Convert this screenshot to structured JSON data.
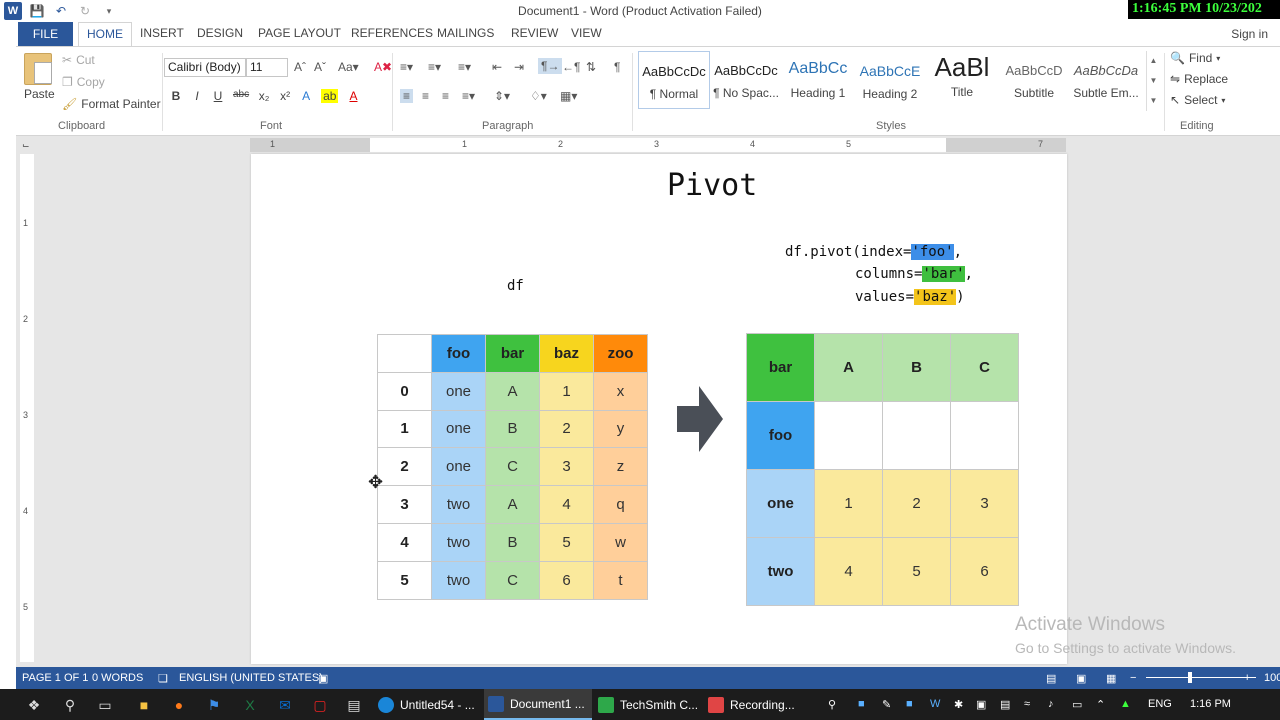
{
  "window": {
    "title": "Document1 - Word (Product Activation Failed)",
    "clock": "1:16:45 PM 10/23/202"
  },
  "tabs": [
    "FILE",
    "HOME",
    "INSERT",
    "DESIGN",
    "PAGE LAYOUT",
    "REFERENCES",
    "MAILINGS",
    "REVIEW",
    "VIEW"
  ],
  "signin": "Sign in",
  "ribbon": {
    "clipboard": {
      "paste": "Paste",
      "cut": "Cut",
      "copy": "Copy",
      "format_painter": "Format Painter",
      "label": "Clipboard"
    },
    "font": {
      "name": "Calibri (Body)",
      "size": "11",
      "label": "Font"
    },
    "paragraph": {
      "label": "Paragraph"
    },
    "styles": {
      "label": "Styles",
      "items": [
        {
          "sample": "AaBbCcDc",
          "name": "¶ Normal"
        },
        {
          "sample": "AaBbCcDc",
          "name": "¶ No Spac..."
        },
        {
          "sample": "AaBbCc",
          "name": "Heading 1"
        },
        {
          "sample": "AaBbCcE",
          "name": "Heading 2"
        },
        {
          "sample": "AaBl",
          "name": "Title"
        },
        {
          "sample": "AaBbCcD",
          "name": "Subtitle"
        },
        {
          "sample": "AaBbCcDa",
          "name": "Subtle Em..."
        }
      ]
    },
    "editing": {
      "find": "Find",
      "replace": "Replace",
      "select": "Select",
      "label": "Editing"
    }
  },
  "document": {
    "title": "Pivot",
    "df_label": "df",
    "code": {
      "l1_pre": "df.pivot(index=",
      "l1_hl": "'foo'",
      "l1_post": ",",
      "l2_pre": "columns=",
      "l2_hl": "'bar'",
      "l2_post": ",",
      "l3_pre": "values=",
      "l3_hl": "'baz'",
      "l3_post": ")"
    },
    "left_table": {
      "headers": [
        "",
        "foo",
        "bar",
        "baz",
        "zoo"
      ],
      "rows": [
        [
          "0",
          "one",
          "A",
          "1",
          "x"
        ],
        [
          "1",
          "one",
          "B",
          "2",
          "y"
        ],
        [
          "2",
          "one",
          "C",
          "3",
          "z"
        ],
        [
          "3",
          "two",
          "A",
          "4",
          "q"
        ],
        [
          "4",
          "two",
          "B",
          "5",
          "w"
        ],
        [
          "5",
          "two",
          "C",
          "6",
          "t"
        ]
      ]
    },
    "right_table": {
      "corner": "bar",
      "columns": [
        "A",
        "B",
        "C"
      ],
      "index_name": "foo",
      "rows": [
        {
          "label": "one",
          "values": [
            "1",
            "2",
            "3"
          ]
        },
        {
          "label": "two",
          "values": [
            "4",
            "5",
            "6"
          ]
        }
      ]
    }
  },
  "watermark": {
    "line1": "Activate Windows",
    "line2": "Go to Settings to activate Windows."
  },
  "status": {
    "page": "PAGE 1 OF 1",
    "words": "0 WORDS",
    "language": "ENGLISH (UNITED STATES)",
    "zoom": "100"
  },
  "taskbar": {
    "apps": [
      "Untitled54 - ...",
      "Document1 ...",
      "TechSmith C...",
      "Recording..."
    ],
    "lang": "ENG",
    "time": "1:16 PM"
  }
}
